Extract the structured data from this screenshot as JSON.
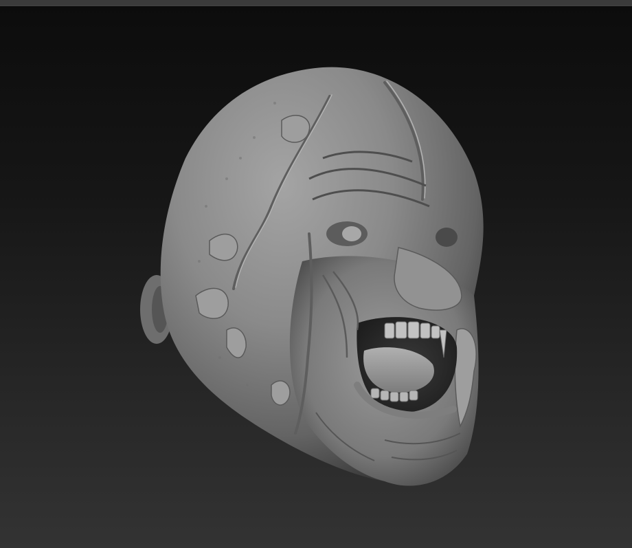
{
  "window": {
    "title": ""
  },
  "viewport": {
    "background_top": "#0c0c0c",
    "background_bottom": "#333333",
    "model": {
      "name": "sculpted-head",
      "material_color": "#8a8a8a"
    }
  }
}
